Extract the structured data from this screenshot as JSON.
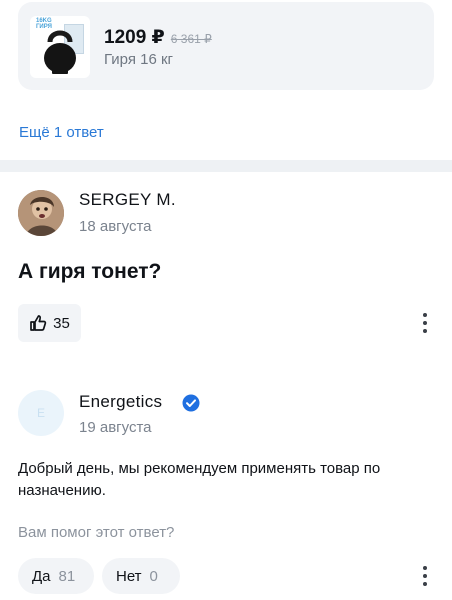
{
  "product": {
    "image_label": "16KG\nГИРЯ",
    "price": "1209 ₽",
    "old_price": "6 361 ₽",
    "name": "Гиря 16 кг"
  },
  "more_answers": "Ещё 1 ответ",
  "question": {
    "author": "SERGEY M.",
    "date": "18 августа",
    "text": "А гиря тонет?",
    "likes": "35"
  },
  "answer": {
    "author": "Energetics",
    "avatar_letter": "E",
    "date": "19 августа",
    "text": "Добрый день, мы рекомендуем применять товар по назначению.",
    "helpful_question": "Вам помог этот ответ?",
    "yes_label": "Да",
    "yes_count": "81",
    "no_label": "Нет",
    "no_count": "0"
  },
  "colors": {
    "link": "#2a79d6",
    "verified": "#1f6fe0",
    "chip_bg": "#f2f4f7",
    "muted_text": "#7b838e"
  },
  "icons": {
    "like": "thumbs-up-icon",
    "menu": "kebab-menu-icon",
    "verified": "verified-check-icon"
  }
}
